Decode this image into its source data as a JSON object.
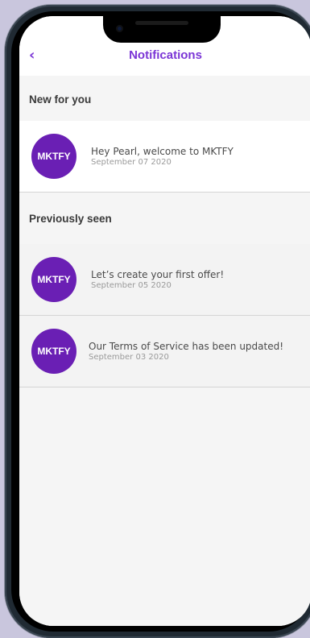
{
  "header": {
    "title": "Notifications",
    "back_icon": "‹"
  },
  "sections": [
    {
      "title": "New for you",
      "items": [
        {
          "avatar": "MKTFY",
          "message": "Hey Pearl, welcome to MKTFY",
          "date": "September 07 2020"
        }
      ]
    },
    {
      "title": "Previously seen",
      "items": [
        {
          "avatar": "MKTFY",
          "message": "Let’s create your first offer!",
          "date": "September 05 2020"
        },
        {
          "avatar": "MKTFY",
          "message": "Our Terms of Service has been updated!",
          "date": "September 03 2020"
        }
      ]
    }
  ],
  "colors": {
    "accent": "#7b35d6",
    "avatar_bg": "#6a1fb4",
    "background": "#c9c6dd"
  }
}
